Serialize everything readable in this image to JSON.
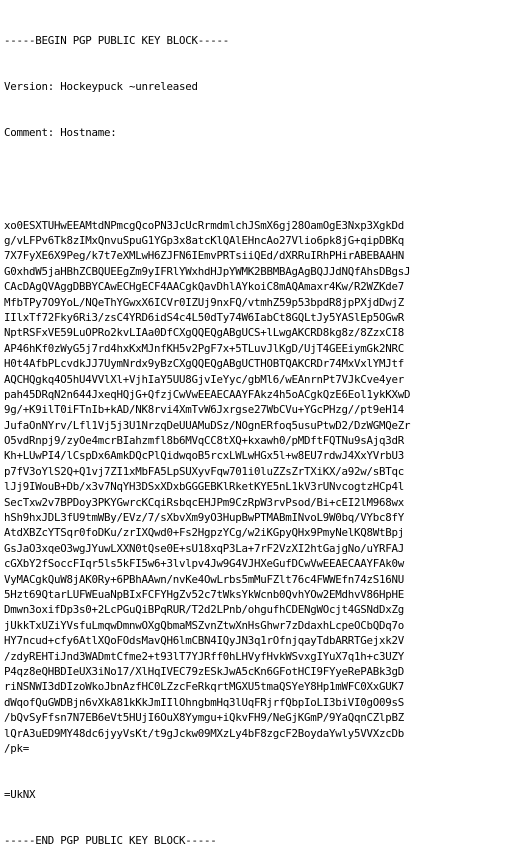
{
  "header": {
    "begin_line": "-----BEGIN PGP PUBLIC KEY BLOCK-----",
    "version_line": "Version: Hockeypuck ~unreleased",
    "comment_line": "Comment: Hostname:"
  },
  "key_lines": [
    "xo0ESXTUHwEEAMtdNPmcgQcoPN3JcUcRrmdmlchJSmX6gj28OamOgE3Nxp3XgkDd",
    "g/vLFPv6Tk8zIMxQnvuSpuG1YGp3x8atcKlQAlEHncAo27Vlio6pk8jG+qipDBKq",
    "7X7FyXE6X9Peg/k7t7eXMLwH6ZJFN6IEmvPRTsiiQEd/dXRRuIRhPHirABEBAAHN",
    "G0xhdW5jaHBhZCBQUEEgZm9yIFRlYWxhdHJpYWMK2BBMBAgAgBQJJdNQfAhsDBgsJ",
    "CAcDAgQVAggDBBYCAwECHgECF4AACgkQavDhlAYkoiC8mAQAmaxr4Kw/R2WZKde7",
    "MfbTPy7O9YoL/NQeThYGwxX6ICVr0IZUj9nxFQ/vtmhZ59p53bpdR8jpPXjdDwjZ",
    "IIlxTf72Fky6Ri3/zsC4YRD6idS4c4L50dTy74W6IabCt8GQLtJy5YASlEp5OGwR",
    "NptRSFxVE59LuOPRo2kvLIAa0DfCXgQQEQgABgUCS+lLwgAKCRD8kg8z/8ZzxCI8",
    "AP46hKf0zWyG5j7rd4hxKxMJnfKH5v2PgF7x+5TLuvJlKgD/UjT4GEEiymGk2NRC",
    "H0t4AfbPLcvdkJJ7UymNrdx9yBzCXgQQEQgABgUCTHOBTQAKCRDr74MxVxlYMJtf",
    "AQCHQgkq4O5hU4VVlXl+VjhIaY5UU8GjvIeYyc/gbMl6/wEAnrnPt7VJkCve4yer",
    "pah45DRqN2n644JxeqHQjG+QfzjCwVwEEAECAAYFAkz4h5oACgkQzE6Eol1ykKXwD",
    "9g/+K9ilT0iFTnIb+kAD/NK8rvi4XmTvW6Jxrgse27WbCVu+YGcPHzg//pt9eH14",
    "JufaOnNYrv/Lfl1Vj5j3U1NrzqDeUUAMuDSz/NOgnERfoq5usuPtwD2/DzWGMQeZr",
    "O5vdRnpj9/zyOe4mcrBIahzmfl8b6MVqCC8tXQ+kxawh0/pMDftFQTNu9sAjq3dR",
    "Kh+LUwPI4/lCspDx6AmkDQcPlQidwqoB5rcxLWLwHGx5l+w8EU7rdwJ4XxYVrbU3",
    "p7fV3oYlS2Q+Q1vj7ZI1xMbFA5LpSUXyvFqw701i0luZZsZrTXiKX/a92w/sBTqc",
    "lJj9IWouB+Db/x3v7NqYH3DSxXDxbGGGEBKlRketKYE5nL1kV3rUNvcogtzHCp4l",
    "SecTxw2v7BPDoy3PKYGwrcKCqiRsbqcEHJPm9CzRpW3rvPsod/Bi+cEI2lM968wx",
    "hSh9hxJDL3fU9tmWBy/EVz/7/sXbvXm9yO3HupBwPTMABmINvoL9W0bq/VYbc8fY",
    "AtdXBZcYTSqr0foDKu/zrIXQwd0+Fs2HgpzYCg/w2iKGpyQHx9PmyNelKQ8WtBpj",
    "GsJaO3xqeO3wgJYuwLXXN0tQse0E+sU18xqP3La+7rF2VzXI2htGajgNo/uYRFAJ",
    "cGXbY2fSoccFIqr5ls5kFI5w6+3lvlpv4Jw9G4VJHXeGufDCwVwEEAECAAYFAk0w",
    "VyMACgkQuW8jAK0Ry+6PBhAAwn/nvKe4OwLrbs5mMuFZlt76c4FWWEfn74zS16NU",
    "5Hzt69QtarLUFWEuaNpBIxFCFYHgZv52c7tWksYkWcnb0QvhYOw2EMdhvV86HpHE",
    "Dmwn3oxifDp3s0+2LcPGuQiBPqRUR/T2d2LPnb/ohgufhCDENgWOcjt4GSNdDxZg",
    "jUkkTxUZiYVsfuLmqwDmnwOXgQbmaMSZvnZtwXnHsGhwr7zDdaxhLcpeOCbQDq7o",
    "HY7ncud+cfy6AtlXQoFOdsMavQH6lmCBN4IQyJN3q1rOfnjqayTdbARRTGejxk2V",
    "/zdyREHTiJnd3WADmtCfme2+t93lT7YJRff0hLHVyfHvkWSvxgIYuX7q1h+c3UZY",
    "P4qz8eQHBDIeUX3iNo17/XlHqIVEC79zESkJwA5cKn6GFotHCI9FYyeRePABk3gD",
    "riNSNWI3dDIzoWkoJbnAzfHC0LZzcFeRkqrtMGXU5tmaQSYeY8Hp1mWFC0XxGUK7",
    "dWqofQuGWDBjn6vXkA81kKkJmIIlOhngbmHq3lUqFRjrfQbpIoLI3biVI0gO09sS",
    "/bQvSyFfsn7N7EB6eVt5HUjI6OuX8Yymgu+iQkvFH9/NeGjKGmP/9YaQqnCZlpBZ",
    "lQrA3uED9MY48dc6jyyVsKt/t9gJckw09MXzLy4bF8zgcF2BoydaYwly5VVXzcDb",
    "/pk="
  ],
  "checksum_line": "=UkNX",
  "footer": {
    "end_line": "-----END PGP PUBLIC KEY BLOCK-----"
  }
}
